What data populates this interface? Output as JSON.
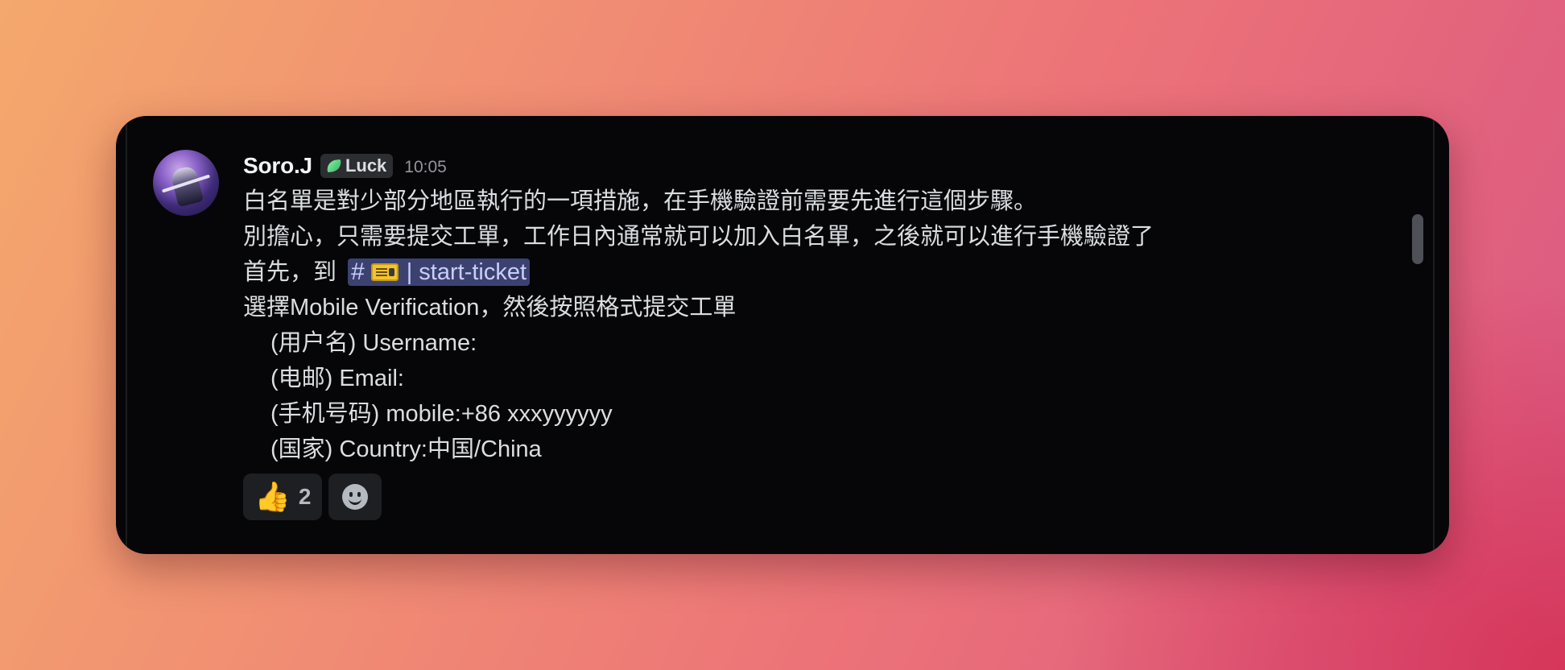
{
  "message": {
    "author": "Soro.J",
    "role": {
      "label": "Luck",
      "icon": "leaf-icon",
      "color": "#2fb565"
    },
    "timestamp": "10:05",
    "lines": {
      "l1": "白名單是對少部分地區執行的一項措施，在手機驗證前需要先進行這個步驟。",
      "l2": "別擔心，只需要提交工單，工作日內通常就可以加入白名單，之後就可以進行手機驗證了",
      "l3_prefix": "首先，到 ",
      "l4": "選擇Mobile Verification，然後按照格式提交工單",
      "l5": "(用户名) Username:",
      "l6": "(电邮) Email:",
      "l7": "(手机号码) mobile:+86 xxxyyyyyy",
      "l8": "(国家) Country:中国/China"
    },
    "channel_mention": {
      "hash": "#",
      "icon": "ticket-icon",
      "separator": "|",
      "name": "start-ticket",
      "color": "#c9cdfb"
    }
  },
  "reactions": [
    {
      "emoji": "👍",
      "icon": "thumbs-up-icon",
      "count": "2"
    }
  ],
  "add_reaction": {
    "icon": "smiley-add-reaction-icon"
  },
  "colors": {
    "card_bg": "#060609",
    "text": "#dbdee1",
    "mention_bg": "#3c4270",
    "timestamp": "#94959c"
  }
}
